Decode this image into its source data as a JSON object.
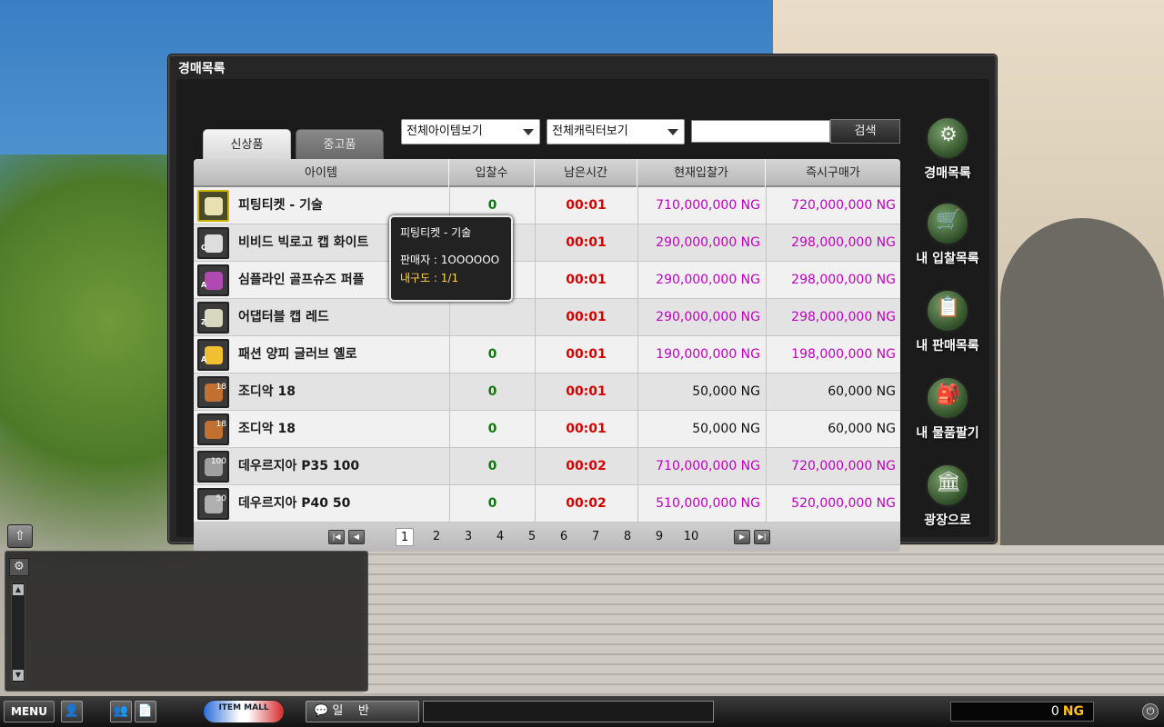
{
  "window": {
    "title": "경매목록"
  },
  "tabs": {
    "new": "신상품",
    "used": "중고품"
  },
  "filters": {
    "item_filter": "전체아이템보기",
    "character_filter": "전체캐릭터보기",
    "search_value": "",
    "search_button": "검색"
  },
  "table": {
    "headers": [
      "아이템",
      "입찰수",
      "남은시간",
      "현재입찰가",
      "즉시구매가"
    ],
    "rows": [
      {
        "tag": "",
        "num": "",
        "name": "피팅티켓 - 기술",
        "bids": "0",
        "time": "00:01",
        "current_price": "710,000,000 NG",
        "buy_now": "720,000,000 NG",
        "icon": "ticket-icon",
        "color": "#e8e0b0"
      },
      {
        "tag": "C",
        "num": "",
        "name": "비비드 빅로고 캡 화이트",
        "bids": "",
        "time": "00:01",
        "current_price": "290,000,000 NG",
        "buy_now": "298,000,000 NG",
        "icon": "cap-icon",
        "color": "#dddddd"
      },
      {
        "tag": "A",
        "num": "",
        "name": "심플라인 골프슈즈 퍼플",
        "bids": "",
        "time": "00:01",
        "current_price": "290,000,000 NG",
        "buy_now": "298,000,000 NG",
        "icon": "shoes-icon",
        "color": "#b04ab0"
      },
      {
        "tag": "Z",
        "num": "",
        "name": "어댑터블 캡 레드",
        "bids": "",
        "time": "00:01",
        "current_price": "290,000,000 NG",
        "buy_now": "298,000,000 NG",
        "icon": "cap-icon",
        "color": "#d8d8c0"
      },
      {
        "tag": "A",
        "num": "",
        "name": "패션 양피 글러브 옐로",
        "bids": "0",
        "time": "00:01",
        "current_price": "190,000,000 NG",
        "buy_now": "198,000,000 NG",
        "icon": "glove-icon",
        "color": "#f0c030"
      },
      {
        "tag": "",
        "num": "18",
        "name": "조디악 18",
        "bids": "0",
        "time": "00:01",
        "current_price": "50,000 NG",
        "buy_now": "60,000 NG",
        "icon": "club-icon",
        "color": "#c07030"
      },
      {
        "tag": "",
        "num": "18",
        "name": "조디악 18",
        "bids": "0",
        "time": "00:01",
        "current_price": "50,000 NG",
        "buy_now": "60,000 NG",
        "icon": "club-icon",
        "color": "#c07030"
      },
      {
        "tag": "",
        "num": "100",
        "name": "데우르지아 P35 100",
        "bids": "0",
        "time": "00:02",
        "current_price": "710,000,000 NG",
        "buy_now": "720,000,000 NG",
        "icon": "ball-icon",
        "color": "#a0a0a0"
      },
      {
        "tag": "",
        "num": "50",
        "name": "데우르지아 P40 50",
        "bids": "0",
        "time": "00:02",
        "current_price": "510,000,000 NG",
        "buy_now": "520,000,000 NG",
        "icon": "ball-icon",
        "color": "#b0b0b0"
      }
    ]
  },
  "pagination": {
    "pages": [
      "1",
      "2",
      "3",
      "4",
      "5",
      "6",
      "7",
      "8",
      "9",
      "10"
    ],
    "current": "1"
  },
  "tooltip": {
    "title": "피팅티켓 - 기술",
    "seller": "판매자 : 1OOOOOO",
    "durability": "내구도 : 1/1"
  },
  "sidebar": [
    {
      "label": "경매목록",
      "icon": "auction-icon",
      "glyph": "⚙"
    },
    {
      "label": "내 입찰목록",
      "icon": "cart-icon",
      "glyph": "🛒"
    },
    {
      "label": "내 판매목록",
      "icon": "clipboard-icon",
      "glyph": "📋"
    },
    {
      "label": "내 물품팔기",
      "icon": "goods-icon",
      "glyph": "🎒"
    },
    {
      "label": "광장으로",
      "icon": "building-icon",
      "glyph": "🏛"
    }
  ],
  "bottom_bar": {
    "menu": "MENU",
    "itemmall": "ITEM MALL",
    "chat_mode": "일    반",
    "ng_value": "0",
    "ng_unit": "NG"
  },
  "colors": {
    "time": "#d60000",
    "bids": "#0b7a0b",
    "price_high": "#c000c0",
    "ng": "#ffc21a"
  }
}
